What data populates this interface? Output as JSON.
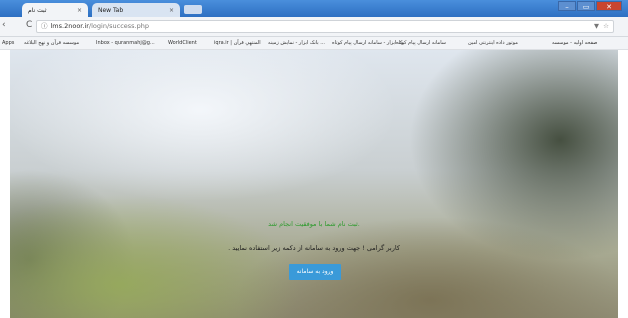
{
  "tabs": [
    {
      "label": "ثبت نام",
      "close": "×"
    },
    {
      "label": "New Tab",
      "close": "×"
    }
  ],
  "window_controls": {
    "minimize": "–",
    "maximize": "▭",
    "close": "✕"
  },
  "toolbar": {
    "back": "‹",
    "reload": "C",
    "address_host": "lms.2noor.ir",
    "address_path": "/login/success.php",
    "info_icon": "ⓘ"
  },
  "bookmarks": [
    "Apps",
    "موسسه قرآن و نهج البلاغه",
    "Inbox - quranmahj@g...",
    "WorldClient",
    "iqra.ir | المنتهي قرآن",
    "بانک ابزار - نمایش زمینه ...",
    "بک ابزار - سامانه ارسال پیام کوتاه",
    "سامانه ارسال پیام کوتاه",
    "موتور داده اینترنتی امین",
    "صفحه اولیه - موسسه"
  ],
  "main": {
    "success_text": "ثبت نام شما با موفقیت انجام شد.",
    "message_text": "کاربر گرامی ! جهت ورود به سامانه از دکمه زیر استفاده نمایید .",
    "enter_button": "ورود به سامانه"
  },
  "colors": {
    "success": "#2f9b2f",
    "button": "#3a9ad9"
  }
}
